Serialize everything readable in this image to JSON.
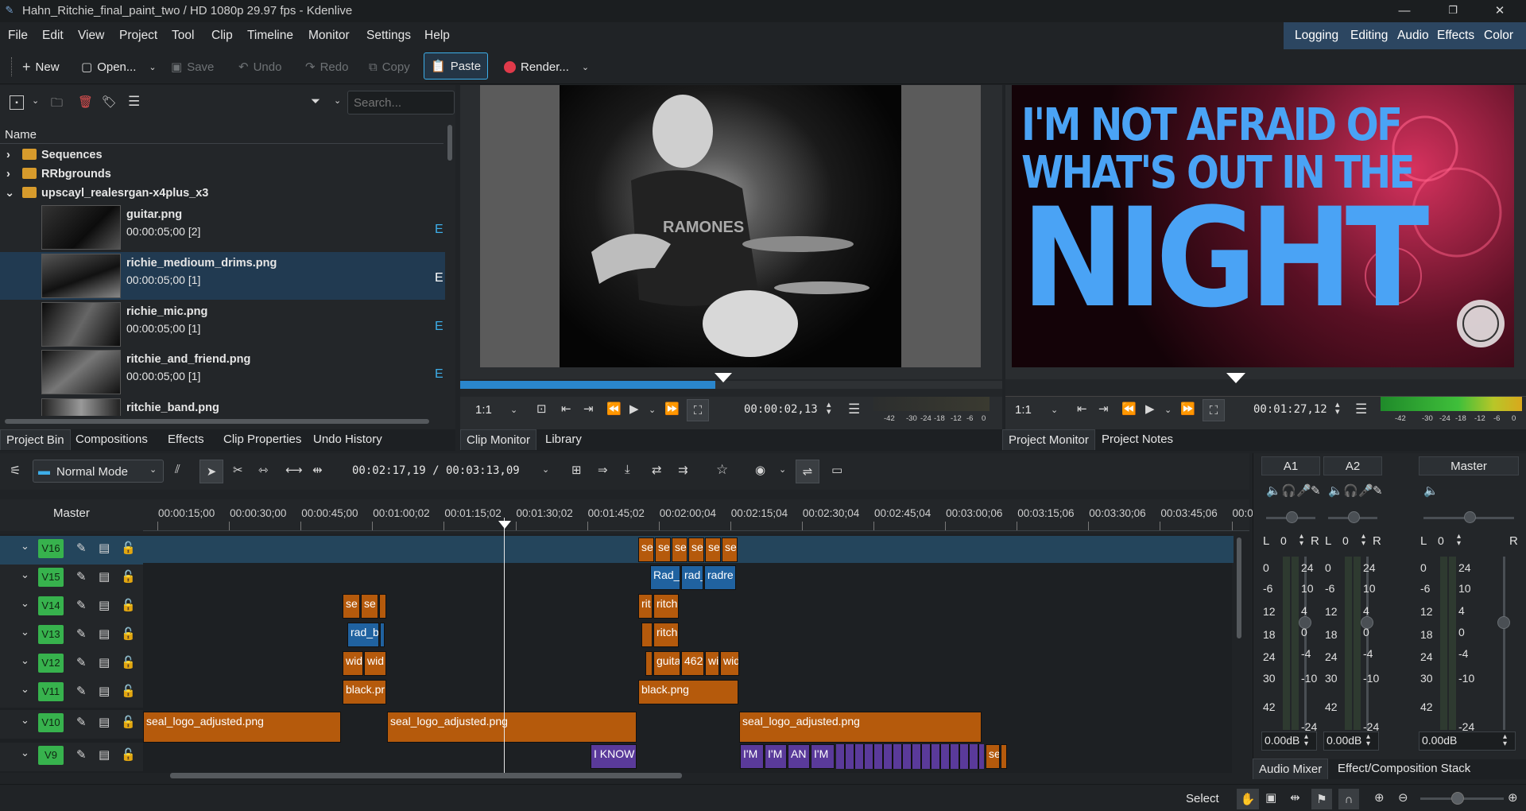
{
  "window": {
    "title": "Hahn_Ritchie_final_paint_two / HD 1080p 29.97 fps - Kdenlive"
  },
  "menu": [
    "File",
    "Edit",
    "View",
    "Project",
    "Tool",
    "Clip",
    "Timeline",
    "Monitor",
    "Settings",
    "Help"
  ],
  "workspaces": [
    "Logging",
    "Editing",
    "Audio",
    "Effects",
    "Color"
  ],
  "toolbar": {
    "new": "New",
    "open": "Open...",
    "save": "Save",
    "undo": "Undo",
    "redo": "Redo",
    "copy": "Copy",
    "paste": "Paste",
    "render": "Render..."
  },
  "bin": {
    "search_placeholder": "Search...",
    "column_name": "Name",
    "folders": [
      "Sequences",
      "RRbgrounds",
      "upscayl_realesrgan-x4plus_x3"
    ],
    "clips": [
      {
        "name": "guitar.png",
        "info": "00:00:05;00 [2]"
      },
      {
        "name": "richie_medioum_drims.png",
        "info": "00:00:05;00 [1]"
      },
      {
        "name": "richie_mic.png",
        "info": "00:00:05;00 [1]"
      },
      {
        "name": "ritchie_and_friend.png",
        "info": "00:00:05;00 [1]"
      },
      {
        "name": "ritchie_band.png",
        "info": ""
      }
    ],
    "tabs": [
      "Project Bin",
      "Compositions",
      "Effects",
      "Clip Properties",
      "Undo History"
    ]
  },
  "clip_monitor": {
    "zoom": "1:1",
    "timecode": "00:00:02,13",
    "meter_scale": [
      "-42",
      "-30",
      "-24",
      "-18",
      "-12",
      "-6",
      "0"
    ],
    "tabs": [
      "Clip Monitor",
      "Library"
    ],
    "progress": 0.47
  },
  "project_monitor": {
    "zoom": "1:1",
    "timecode": "00:01:27,12",
    "meter_scale": [
      "-42",
      "-30",
      "-24",
      "-18",
      "-12",
      "-6",
      "0"
    ],
    "tabs": [
      "Project Monitor",
      "Project Notes"
    ],
    "title_lines": [
      "I'M NOT AFRAID OF",
      "WHAT'S OUT IN THE",
      "NIGHT"
    ]
  },
  "timeline": {
    "mode": "Normal Mode",
    "position": "00:02:17,19 / 00:03:13,09",
    "master_label": "Master",
    "ruler": [
      "00:00:15;00",
      "00:00:30;00",
      "00:00:45;00",
      "00:01:00;02",
      "00:01:15;02",
      "00:01:30;02",
      "00:01:45;02",
      "00:02:00;04",
      "00:02:15;04",
      "00:02:30;04",
      "00:02:45;04",
      "00:03:00;06",
      "00:03:15;06",
      "00:03:30;06",
      "00:03:45;06",
      "00:0"
    ],
    "tracks": [
      "V16",
      "V15",
      "V14",
      "V13",
      "V12",
      "V11",
      "V10",
      "V9"
    ],
    "clip_labels": {
      "v16": [
        "se",
        "se",
        "se",
        "se",
        "se",
        "se"
      ],
      "v15": [
        "Rad_",
        "rad_",
        "radre"
      ],
      "v14": [
        "se",
        "se",
        "rit",
        "ritch"
      ],
      "v13": [
        "rad_b",
        "ritch"
      ],
      "v12": [
        "wid",
        "wid",
        "guita",
        "462",
        "wi",
        "wid"
      ],
      "v11": [
        "black.pr",
        "black.png"
      ],
      "v10": [
        "seal_logo_adjusted.png",
        "seal_logo_adjusted.png",
        "seal_logo_adjusted.png"
      ],
      "v9": [
        "I KNOW",
        "I'M",
        "I'M",
        "AN",
        "I'M",
        "se"
      ]
    }
  },
  "mixer": {
    "channels": [
      {
        "name": "A1",
        "l": "L",
        "r": "R",
        "value": "0",
        "db": "0.00dB"
      },
      {
        "name": "A2",
        "l": "L",
        "r": "R",
        "value": "0",
        "db": "0.00dB"
      },
      {
        "name": "Master",
        "l": "L",
        "r": "R",
        "value": "0",
        "db": "0.00dB"
      }
    ],
    "scale_left": [
      "0",
      "-6",
      "12",
      "18",
      "24",
      "30",
      "42"
    ],
    "scale_right": [
      "24",
      "10",
      "4",
      "0",
      "-4",
      "-10",
      "-24"
    ],
    "tabs": [
      "Audio Mixer",
      "Effect/Composition Stack"
    ]
  },
  "status": {
    "tool": "Select"
  },
  "colors": {
    "accent": "#3daee9",
    "clip_orange": "#b55a0c",
    "clip_blue": "#2062a0",
    "track_green": "#37b24d",
    "title_blue": "#4aa3f5"
  }
}
